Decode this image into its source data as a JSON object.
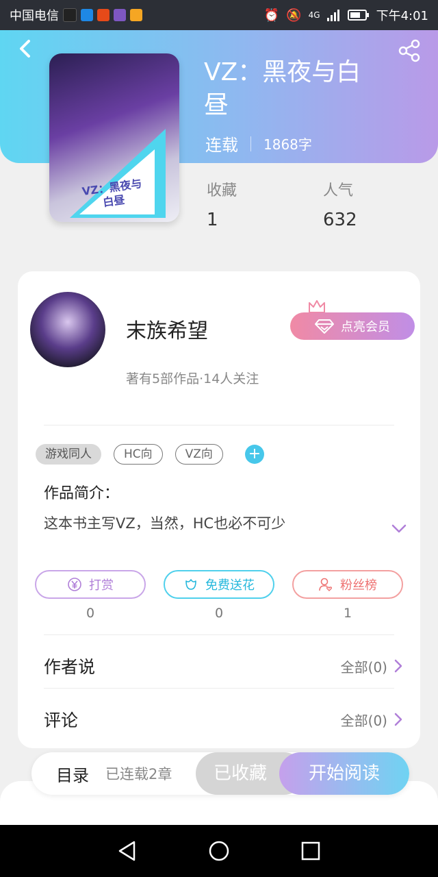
{
  "status_bar": {
    "carrier": "中国电信",
    "time": "下午4:01",
    "network": "4G"
  },
  "book": {
    "title": "VZ：黑夜与白昼",
    "cover_text": "VZ：黑夜与白昼",
    "status": "连载",
    "word_count": "1868字",
    "stats": [
      {
        "label": "收藏",
        "value": "1"
      },
      {
        "label": "人气",
        "value": "632"
      }
    ]
  },
  "author": {
    "name": "末族希望",
    "subtitle": "著有5部作品·14人关注",
    "vip_label": "点亮会员"
  },
  "tags": [
    "游戏同人",
    "HC向",
    "VZ向"
  ],
  "intro": {
    "heading": "作品简介：",
    "text": "这本书主写VZ，当然，HC也必不可少"
  },
  "actions": [
    {
      "label": "打赏",
      "count": "0",
      "color": "#b07fd8",
      "icon": "yen-icon"
    },
    {
      "label": "免费送花",
      "count": "0",
      "color": "#3cc6e6",
      "icon": "flower-icon"
    },
    {
      "label": "粉丝榜",
      "count": "1",
      "color": "#f08080",
      "icon": "fan-icon"
    }
  ],
  "rows": [
    {
      "label": "作者说",
      "right": "全部(0)"
    },
    {
      "label": "评论",
      "right": "全部(0)"
    }
  ],
  "bottom": {
    "toc": "目录",
    "chapters": "已连载2章",
    "collected": "已收藏",
    "read": "开始阅读"
  }
}
